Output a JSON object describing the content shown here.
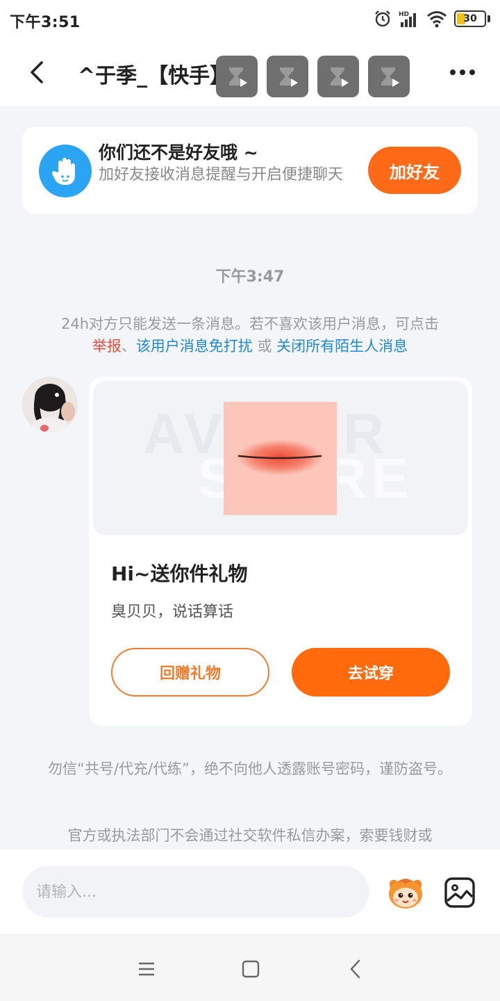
{
  "status_bar": {
    "time": "下午3:51",
    "battery": "30",
    "network": "HD"
  },
  "header": {
    "title": "^于季_【快手】",
    "thumbnail_count": 4
  },
  "friend_banner": {
    "title": "你们还不是好友哦 ~",
    "description": "加好友接收消息提醒与开启便捷聊天",
    "button": "加好友"
  },
  "chat": {
    "timestamp": "下午3:47",
    "notice_text": "24h对方只能发送一条消息。若不喜欢该用户消息，可点击",
    "notice_report": "举报",
    "notice_sep1": "、",
    "notice_dnd": "该用户消息免打扰",
    "notice_or": " 或 ",
    "notice_close_all": "关闭所有陌生人消息"
  },
  "gift_card": {
    "watermark_line1": "AVATAR",
    "watermark_line2": "STORE",
    "title": "Hi~送你件礼物",
    "subtitle": "臭贝贝，说话算话",
    "return_button": "回赠礼物",
    "try_button": "去试穿"
  },
  "warnings": {
    "line1": "勿信“共号/代充/代练”，绝不向他人透露账号密码，谨防盗号。",
    "line2": "官方或执法部门不会通过社交软件私信办案，索要钱财或"
  },
  "input_bar": {
    "placeholder": "请输入..."
  },
  "colors": {
    "accent": "#fe6a18",
    "link_blue": "#1e88d5",
    "report_red": "#e74c3c"
  }
}
